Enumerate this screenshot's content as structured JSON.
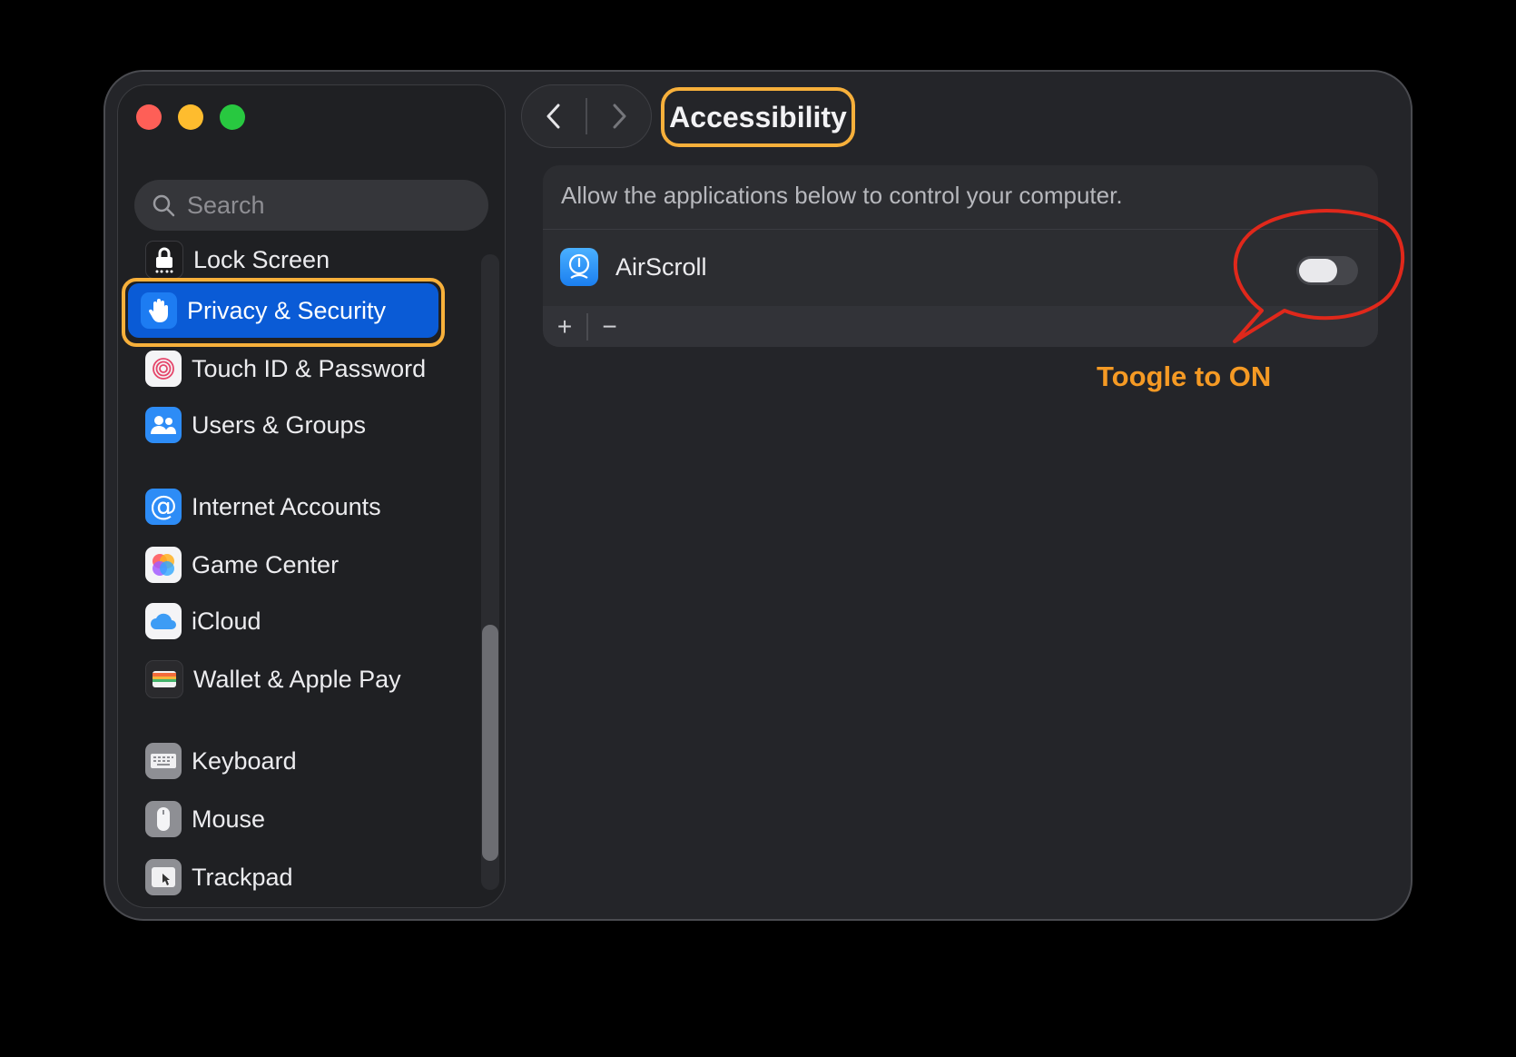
{
  "window": {
    "traffic_lights": [
      "close",
      "minimize",
      "zoom"
    ]
  },
  "sidebar": {
    "search_placeholder": "Search",
    "items": [
      {
        "label": "Lock Screen",
        "icon": "lock-icon"
      },
      {
        "label": "Privacy & Security",
        "icon": "hand-icon",
        "selected": true
      },
      {
        "label": "Touch ID & Password",
        "icon": "fingerprint-icon"
      },
      {
        "label": "Users & Groups",
        "icon": "users-icon"
      },
      {
        "label": "Internet Accounts",
        "icon": "at-sign-icon"
      },
      {
        "label": "Game Center",
        "icon": "game-center-icon"
      },
      {
        "label": "iCloud",
        "icon": "cloud-icon"
      },
      {
        "label": "Wallet & Apple Pay",
        "icon": "wallet-icon"
      },
      {
        "label": "Keyboard",
        "icon": "keyboard-icon"
      },
      {
        "label": "Mouse",
        "icon": "mouse-icon"
      },
      {
        "label": "Trackpad",
        "icon": "trackpad-icon"
      }
    ]
  },
  "toolbar": {
    "title": "Accessibility",
    "back_icon": "chevron-left-icon",
    "forward_icon": "chevron-right-icon"
  },
  "main": {
    "description": "Allow the applications below to control your computer.",
    "apps": [
      {
        "name": "AirScroll",
        "icon": "airscroll-icon",
        "enabled": false
      }
    ],
    "add_label": "+",
    "remove_label": "−"
  },
  "annotation": {
    "text": "Toogle to ON",
    "color": "#f59a24",
    "circle_color": "#e0281b"
  },
  "colors": {
    "selected": "#0a5bd6",
    "highlight": "#f7b03b"
  }
}
